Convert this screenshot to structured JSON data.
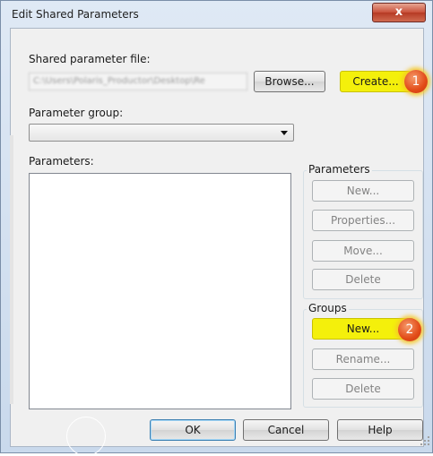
{
  "window": {
    "title": "Edit Shared Parameters",
    "close_label": "x"
  },
  "shared_file": {
    "label": "Shared parameter file:",
    "path_value": "C:\\Users\\Polaris_Productor\\Desktop\\Re",
    "browse_label": "Browse...",
    "create_label": "Create...",
    "create_callout": "1"
  },
  "parameter_group": {
    "label": "Parameter group:",
    "selected": ""
  },
  "parameters_list": {
    "label": "Parameters:"
  },
  "parameters_box": {
    "caption": "Parameters",
    "new_label": "New...",
    "properties_label": "Properties...",
    "move_label": "Move...",
    "delete_label": "Delete"
  },
  "groups_box": {
    "caption": "Groups",
    "new_label": "New...",
    "new_callout": "2",
    "rename_label": "Rename...",
    "delete_label": "Delete"
  },
  "footer": {
    "ok_label": "OK",
    "cancel_label": "Cancel",
    "help_label": "Help"
  },
  "colors": {
    "highlight": "#f4f00b",
    "callout": "#e24b17",
    "close_button": "#c9503a"
  }
}
